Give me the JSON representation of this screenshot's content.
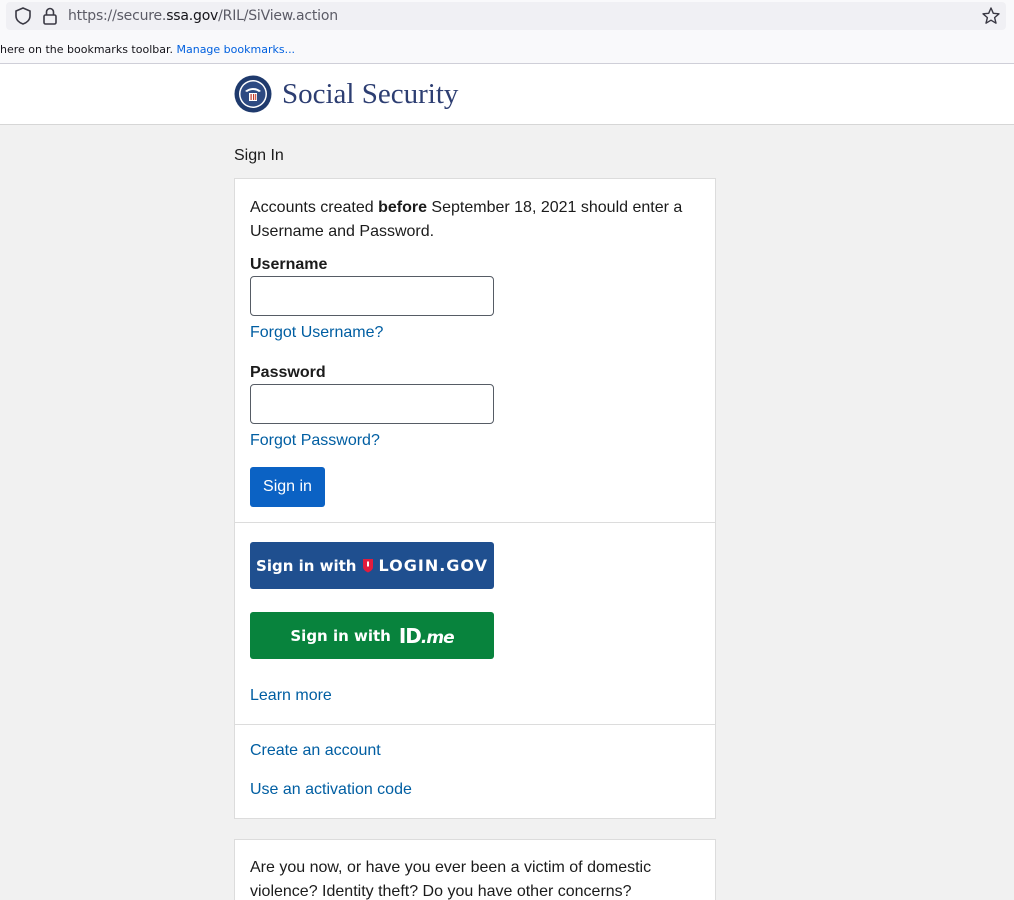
{
  "browser": {
    "url_prefix": "https://secure.",
    "url_domain": "ssa.gov",
    "url_path": "/RIL/SiView.action",
    "bookmarks_text": "here on the bookmarks toolbar.",
    "bookmarks_link": "Manage bookmarks..."
  },
  "header": {
    "brand": "Social Security"
  },
  "page": {
    "title": "Sign In"
  },
  "signin_card": {
    "intro_pre": "Accounts created ",
    "intro_bold": "before",
    "intro_post": " September 18, 2021 should enter a Username and Password.",
    "username_label": "Username",
    "username_value": "",
    "forgot_username": "Forgot Username?",
    "password_label": "Password",
    "password_value": "",
    "forgot_password": "Forgot Password?",
    "signin_button": "Sign in",
    "logingov_prefix": "Sign in with",
    "logingov_brand": "LOGIN.GOV",
    "idme_prefix": "Sign in with",
    "idme_id": "ID",
    "idme_me": ".me",
    "learn_more": "Learn more",
    "create_account": "Create an account",
    "activation_code": "Use an activation code"
  },
  "concerns_card": {
    "text": "Are you now, or have you ever been a victim of domestic violence? Identity theft? Do you have other concerns?"
  },
  "colors": {
    "brand_navy": "#2d3e72",
    "link_blue": "#005ea2",
    "signin_blue": "#0b62c4",
    "logingov_blue": "#1f4f8f",
    "idme_green": "#08833d"
  },
  "icons": [
    "shield-icon",
    "lock-icon",
    "star-icon",
    "ssa-seal-icon",
    "logingov-shield-icon"
  ]
}
